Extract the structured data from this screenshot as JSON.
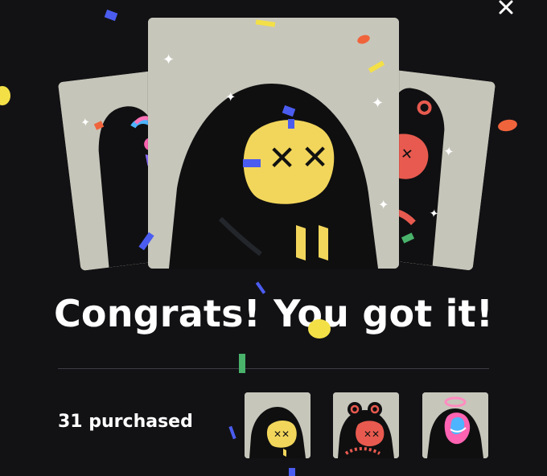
{
  "modal": {
    "close_icon": "close-icon",
    "headline": "Congrats! You got it!",
    "purchased_label": "31 purchased"
  },
  "cards": {
    "featured": "black hooded creature with yellow face and x eyes",
    "left": "black hooded creature with pink halo",
    "right": "black creature with red ears and red face"
  },
  "thumbnails": [
    {
      "icon": "yellow-face-creature-thumbnail"
    },
    {
      "icon": "red-ear-creature-thumbnail"
    },
    {
      "icon": "halo-creature-thumbnail"
    }
  ],
  "colors": {
    "background": "#121215",
    "card": "#c7c6bb",
    "creature": "#0f0f10",
    "face_yellow": "#f2d65b",
    "face_red": "#e85a4f",
    "confetti_orange": "#f0643c",
    "confetti_blue": "#4b5cf0",
    "confetti_yellow": "#f3e047",
    "confetti_green": "#49b26b"
  }
}
